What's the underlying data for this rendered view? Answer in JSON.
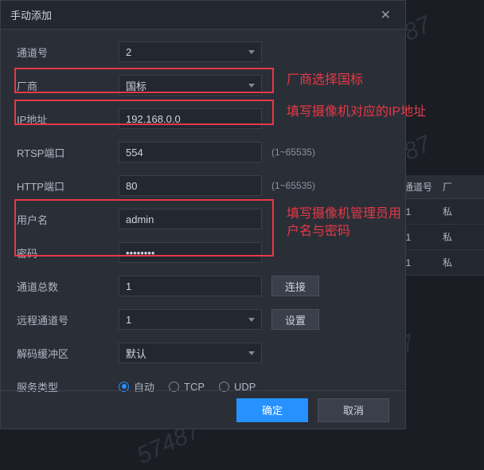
{
  "dialog": {
    "title": "手动添加"
  },
  "fields": {
    "channel": {
      "label": "通道号",
      "value": "2"
    },
    "vendor": {
      "label": "厂商",
      "value": "国标"
    },
    "ip": {
      "label": "IP地址",
      "value": "192.168.0.0"
    },
    "rtsp": {
      "label": "RTSP端口",
      "value": "554",
      "hint": "(1~65535)"
    },
    "http": {
      "label": "HTTP端口",
      "value": "80",
      "hint": "(1~65535)"
    },
    "user": {
      "label": "用户名",
      "value": "admin"
    },
    "pass": {
      "label": "密码",
      "value": "••••••••"
    },
    "total": {
      "label": "通道总数",
      "value": "1"
    },
    "remote": {
      "label": "远程通道号",
      "value": "1"
    },
    "decode": {
      "label": "解码缓冲区",
      "value": "默认"
    },
    "service": {
      "label": "服务类型"
    }
  },
  "buttons": {
    "connect": "连接",
    "settings": "设置",
    "ok": "确定",
    "cancel": "取消"
  },
  "radios": {
    "auto": "自动",
    "tcp": "TCP",
    "udp": "UDP"
  },
  "annotations": {
    "vendor": "厂商选择国标",
    "ip": "填写摄像机对应的IP地址",
    "userpass": "填写摄像机管理员用户名与密码"
  },
  "bg_table": {
    "col1": "远程通道号",
    "col2": "厂",
    "rows": [
      {
        "c1": "1",
        "c2": "私"
      },
      {
        "c1": "1",
        "c2": "私"
      },
      {
        "c1": "1",
        "c2": "私"
      }
    ]
  },
  "watermark": "57487"
}
